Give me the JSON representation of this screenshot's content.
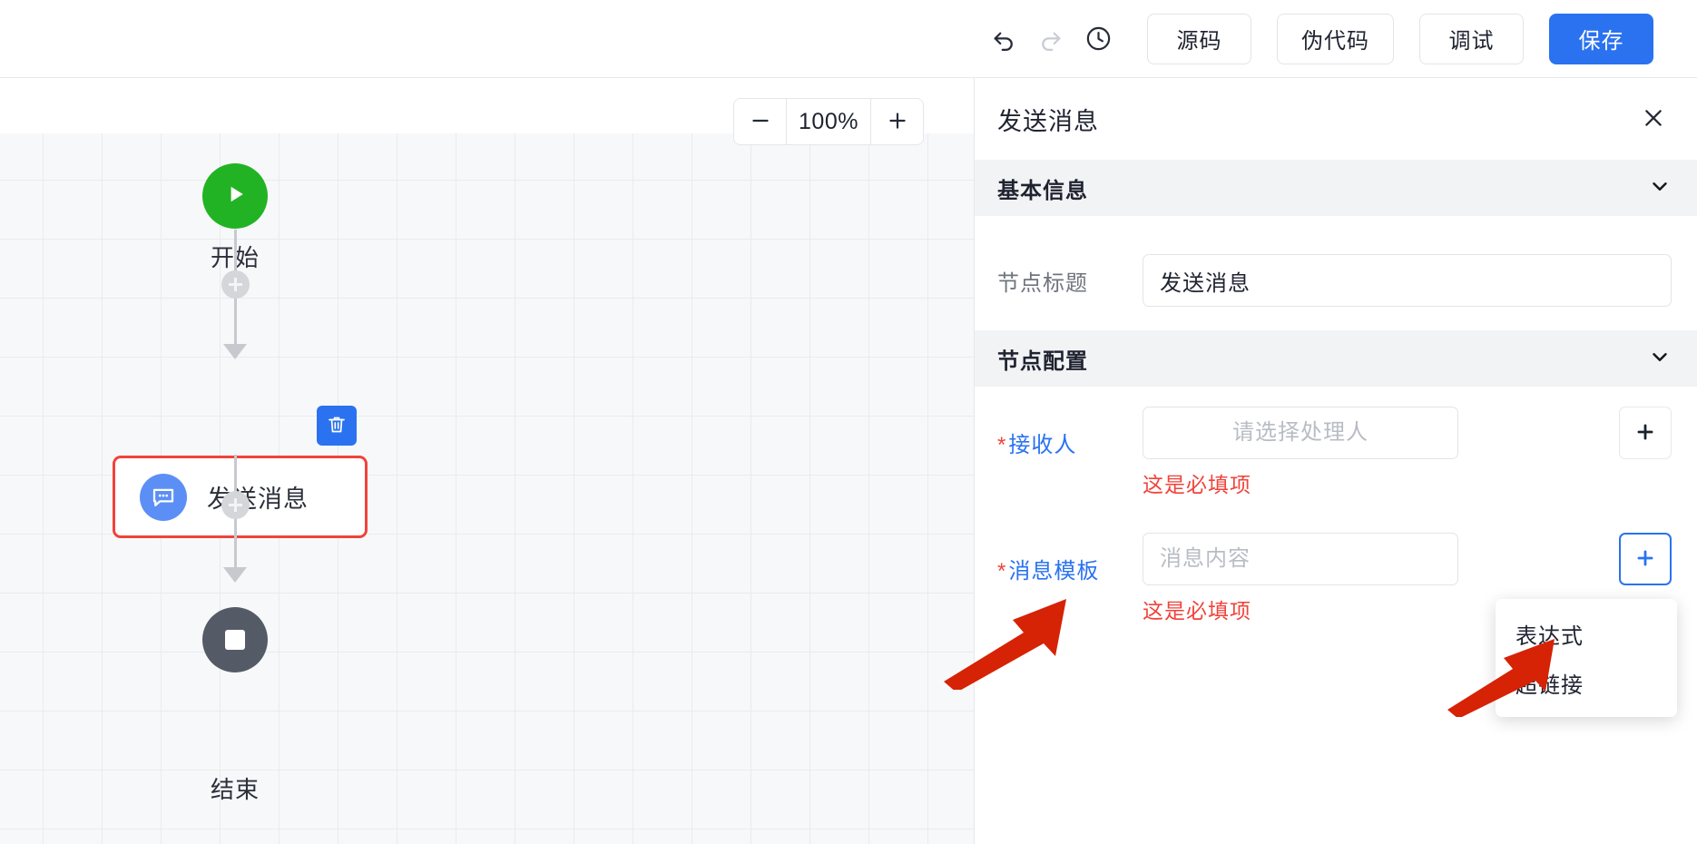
{
  "toolbar": {
    "undo_icon": "undo-icon",
    "redo_icon": "redo-icon",
    "history_icon": "clock-history-icon",
    "buttons": [
      {
        "label": "源码",
        "style": "default"
      },
      {
        "label": "伪代码",
        "style": "default"
      },
      {
        "label": "调试",
        "style": "default"
      },
      {
        "label": "保存",
        "style": "primary"
      }
    ]
  },
  "canvas": {
    "zoom": {
      "minus_label": "−",
      "value": "100%",
      "plus_label": "+"
    },
    "nodes": [
      {
        "id": "start",
        "label": "开始",
        "type": "start",
        "icon": "play-icon",
        "color": "#22b324"
      },
      {
        "id": "send-message",
        "label": "发送消息",
        "type": "task",
        "icon": "message-bubble-icon",
        "color": "#5c8ff5",
        "selected": true
      },
      {
        "id": "end",
        "label": "结束",
        "type": "end",
        "icon": "stop-square-icon",
        "color": "#555b66"
      }
    ],
    "delete_icon": "trash-icon",
    "add_connector_icon": "plus-icon"
  },
  "panel": {
    "title": "发送消息",
    "close_icon": "close-icon",
    "sections": [
      {
        "title": "基本信息",
        "chevron_icon": "chevron-down-icon"
      },
      {
        "title": "节点配置",
        "chevron_icon": "chevron-down-icon"
      }
    ],
    "fields": {
      "node_title": {
        "label": "节点标题",
        "value": "发送消息",
        "placeholder": ""
      },
      "receiver": {
        "label": "接收人",
        "required_mark": "*",
        "value": "",
        "placeholder": "请选择处理人",
        "error": "这是必填项",
        "add_icon": "plus-icon"
      },
      "message_template": {
        "label": "消息模板",
        "required_mark": "*",
        "value": "",
        "placeholder": "消息内容",
        "error": "这是必填项",
        "add_icon": "plus-icon"
      }
    },
    "dropdown": {
      "items": [
        {
          "label": "表达式"
        },
        {
          "label": "超链接"
        }
      ]
    }
  },
  "annotations": {
    "arrow_color": "#d62205",
    "arrows": [
      {
        "target": "消息模板"
      },
      {
        "target": "表达式"
      }
    ]
  },
  "colors": {
    "primary": "#2a72f0",
    "danger": "#f0433a",
    "start_node": "#22b324",
    "end_node": "#555b66",
    "task_node": "#5c8ff5",
    "panel_section_bg": "#f2f3f5",
    "canvas_bg": "#f7f8fa"
  }
}
